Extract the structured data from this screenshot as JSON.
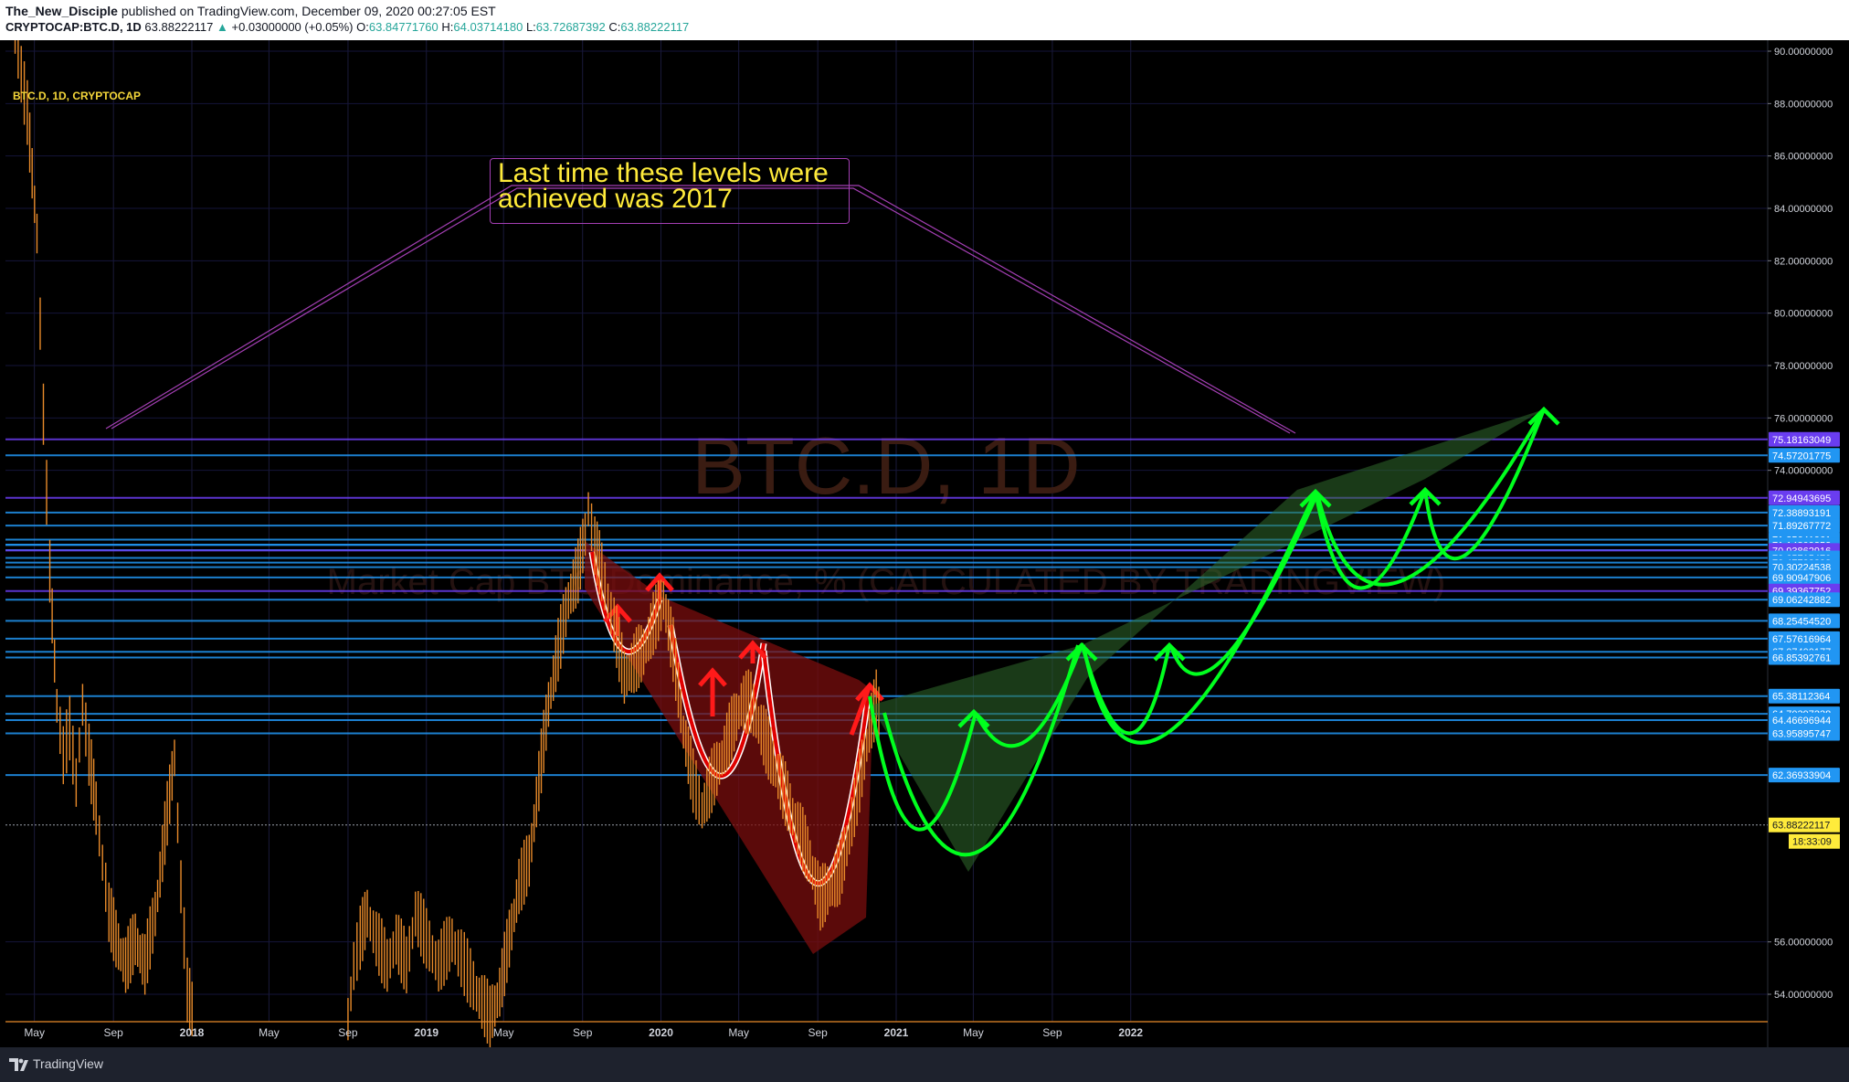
{
  "header": {
    "author": "The_New_Disciple",
    "published_text": "published on TradingView.com, December 09, 2020 00:27:05 EST",
    "symbol": "CRYPTOCAP:BTC.D, 1D",
    "last": "63.88222117",
    "change": "+0.03000000 (+0.05%)",
    "o_label": "O:",
    "o": "63.84771760",
    "h_label": "H:",
    "h": "64.03714180",
    "l_label": "L:",
    "l": "63.72687392",
    "c_label": "C:",
    "c": "63.88222117"
  },
  "legend": "BTC.D, 1D, CRYPTOCAP",
  "annotation": {
    "line1": "Last time these levels were",
    "line2": "achieved was 2017"
  },
  "watermark": {
    "title": "BTC.D, 1D",
    "subtitle": "Market Cap BTC Dominance, % (CALCULATED BY TRADINGVIEW)"
  },
  "footer": {
    "brand": "TradingView"
  },
  "colors": {
    "candle": "#e98b2a",
    "levels_blue": "#2196f3",
    "levels_purple": "#6a3df0",
    "bearish": "#b71c1c",
    "bullish": "#00ff1e",
    "annotation": "#a43fb4"
  },
  "chart_data": {
    "type": "line",
    "y_unit": "%",
    "ylim": [
      53,
      91
    ],
    "x_range": [
      "2017-04-01",
      "2022-12-31"
    ],
    "x_ticks": [
      {
        "label": "May",
        "date": "2017-05-01"
      },
      {
        "label": "Sep",
        "date": "2017-09-01"
      },
      {
        "label": "2018",
        "date": "2018-01-01"
      },
      {
        "label": "May",
        "date": "2018-05-01"
      },
      {
        "label": "Sep",
        "date": "2018-09-01"
      },
      {
        "label": "2019",
        "date": "2019-01-01"
      },
      {
        "label": "May",
        "date": "2019-05-01"
      },
      {
        "label": "Sep",
        "date": "2019-09-01"
      },
      {
        "label": "2020",
        "date": "2020-01-01"
      },
      {
        "label": "May",
        "date": "2020-05-01"
      },
      {
        "label": "Sep",
        "date": "2020-09-01"
      },
      {
        "label": "2021",
        "date": "2021-01-01"
      },
      {
        "label": "May",
        "date": "2021-05-01"
      },
      {
        "label": "Sep",
        "date": "2021-09-01"
      },
      {
        "label": "2022",
        "date": "2022-01-01"
      }
    ],
    "y_ticks": [
      "90.00000000",
      "88.00000000",
      "86.00000000",
      "84.00000000",
      "82.00000000",
      "80.00000000",
      "78.00000000",
      "76.00000000",
      "74.00000000",
      "56.00000000",
      "54.00000000"
    ],
    "levels": [
      {
        "value": 75.18163049,
        "label": "75.18163049",
        "color": "#6a3df0"
      },
      {
        "value": 74.57201775,
        "label": "74.57201775",
        "color": "#2196f3"
      },
      {
        "value": 72.94943695,
        "label": "72.94943695",
        "color": "#6a3df0"
      },
      {
        "value": 72.38893191,
        "label": "72.38893191",
        "color": "#2196f3"
      },
      {
        "value": 71.89267772,
        "label": "71.89267772",
        "color": "#2196f3"
      },
      {
        "value": 71.35641961,
        "label": "71.35641961",
        "color": "#2196f3"
      },
      {
        "value": 71.16234274,
        "label": "71.16234274",
        "color": "#2196f3"
      },
      {
        "value": 71.14809852,
        "label": "71.14809852",
        "color": "#2196f3"
      },
      {
        "value": 70.95402165,
        "label": "70.95402165",
        "color": "#2196f3"
      },
      {
        "value": 70.93862916,
        "label": "70.93862916",
        "color": "#6a3df0"
      },
      {
        "value": 70.6571547,
        "label": "70.65715470",
        "color": "#2196f3"
      },
      {
        "value": 70.47733398,
        "label": "70.47733398",
        "color": "#2196f3"
      },
      {
        "value": 70.30224538,
        "label": "70.30224538",
        "color": "#2196f3"
      },
      {
        "value": 69.90947906,
        "label": "69.90947906",
        "color": "#2196f3"
      },
      {
        "value": 69.39367752,
        "label": "69.39367752",
        "color": "#6a3df0"
      },
      {
        "value": 69.06242882,
        "label": "69.06242882",
        "color": "#2196f3"
      },
      {
        "value": 68.2545452,
        "label": "68.25454520",
        "color": "#2196f3"
      },
      {
        "value": 67.57616964,
        "label": "67.57616964",
        "color": "#2196f3"
      },
      {
        "value": 67.07400177,
        "label": "67.07400177",
        "color": "#2196f3"
      },
      {
        "value": 66.85392761,
        "label": "66.85392761",
        "color": "#2196f3"
      },
      {
        "value": 65.38112364,
        "label": "65.38112364",
        "color": "#2196f3"
      },
      {
        "value": 64.70397238,
        "label": "64.70397238",
        "color": "#2196f3"
      },
      {
        "value": 64.46696944,
        "label": "64.46696944",
        "color": "#2196f3"
      },
      {
        "value": 63.95895747,
        "label": "63.95895747",
        "color": "#2196f3"
      },
      {
        "value": 62.36933904,
        "label": "62.36933904",
        "color": "#2196f3"
      }
    ],
    "current_price": {
      "value": 63.88222117,
      "label": "63.88222117",
      "countdown": "18:33:09",
      "color": "#ffeb3b"
    },
    "series": [
      {
        "values": [
          [
            "2017-04-01",
            90.5
          ],
          [
            "2017-04-20",
            87.5
          ],
          [
            "2017-05-05",
            83
          ],
          [
            "2017-05-15",
            76
          ],
          [
            "2017-05-25",
            70
          ],
          [
            "2017-06-05",
            65
          ],
          [
            "2017-06-15",
            63
          ],
          [
            "2017-06-25",
            64
          ],
          [
            "2017-07-05",
            62
          ],
          [
            "2017-07-15",
            65
          ],
          [
            "2017-07-25",
            63
          ],
          [
            "2017-08-05",
            61
          ],
          [
            "2017-08-15",
            59
          ],
          [
            "2017-08-25",
            57
          ],
          [
            "2017-09-05",
            56
          ],
          [
            "2017-09-20",
            55
          ],
          [
            "2017-10-05",
            56
          ],
          [
            "2017-10-20",
            55
          ],
          [
            "2017-11-05",
            57
          ],
          [
            "2017-11-20",
            60
          ],
          [
            "2017-12-05",
            63
          ],
          [
            "2017-12-15",
            58
          ],
          [
            "2017-12-25",
            54
          ],
          [
            "2018-01-05",
            53
          ]
        ]
      },
      {
        "values": [
          [
            "2018-09-01",
            53
          ],
          [
            "2018-09-10",
            55
          ],
          [
            "2018-09-20",
            56
          ],
          [
            "2018-10-01",
            57
          ],
          [
            "2018-10-15",
            56
          ],
          [
            "2018-11-01",
            55
          ],
          [
            "2018-11-15",
            56
          ],
          [
            "2018-12-01",
            55
          ],
          [
            "2018-12-15",
            57
          ],
          [
            "2019-01-01",
            56
          ],
          [
            "2019-01-20",
            55
          ],
          [
            "2019-02-10",
            56
          ],
          [
            "2019-03-01",
            55
          ],
          [
            "2019-03-20",
            54
          ],
          [
            "2019-04-10",
            53
          ],
          [
            "2019-04-25",
            54
          ],
          [
            "2019-05-10",
            56
          ],
          [
            "2019-05-25",
            58
          ],
          [
            "2019-06-10",
            59
          ],
          [
            "2019-06-25",
            62
          ],
          [
            "2019-07-10",
            65
          ],
          [
            "2019-07-25",
            67
          ],
          [
            "2019-08-10",
            69
          ],
          [
            "2019-08-25",
            70
          ],
          [
            "2019-09-05",
            71.5
          ],
          [
            "2019-09-10",
            72.5
          ],
          [
            "2019-09-20",
            71
          ],
          [
            "2019-10-01",
            70
          ],
          [
            "2019-10-20",
            68
          ],
          [
            "2019-11-05",
            66
          ],
          [
            "2019-11-20",
            66.5
          ],
          [
            "2019-12-05",
            67
          ],
          [
            "2019-12-20",
            68
          ],
          [
            "2020-01-05",
            69
          ],
          [
            "2020-01-20",
            67
          ],
          [
            "2020-02-05",
            64
          ],
          [
            "2020-02-20",
            62
          ],
          [
            "2020-03-05",
            61
          ],
          [
            "2020-03-20",
            62
          ],
          [
            "2020-04-05",
            63
          ],
          [
            "2020-04-20",
            64
          ],
          [
            "2020-05-05",
            65
          ],
          [
            "2020-05-20",
            65
          ],
          [
            "2020-06-05",
            64
          ],
          [
            "2020-06-20",
            63
          ],
          [
            "2020-07-05",
            62
          ],
          [
            "2020-07-20",
            61
          ],
          [
            "2020-08-05",
            60
          ],
          [
            "2020-08-20",
            59
          ],
          [
            "2020-09-05",
            57.5
          ],
          [
            "2020-09-20",
            58
          ],
          [
            "2020-10-05",
            58.5
          ],
          [
            "2020-10-20",
            60
          ],
          [
            "2020-11-05",
            62
          ],
          [
            "2020-11-20",
            64
          ],
          [
            "2020-12-01",
            65
          ],
          [
            "2020-12-09",
            63.88
          ]
        ]
      }
    ]
  }
}
